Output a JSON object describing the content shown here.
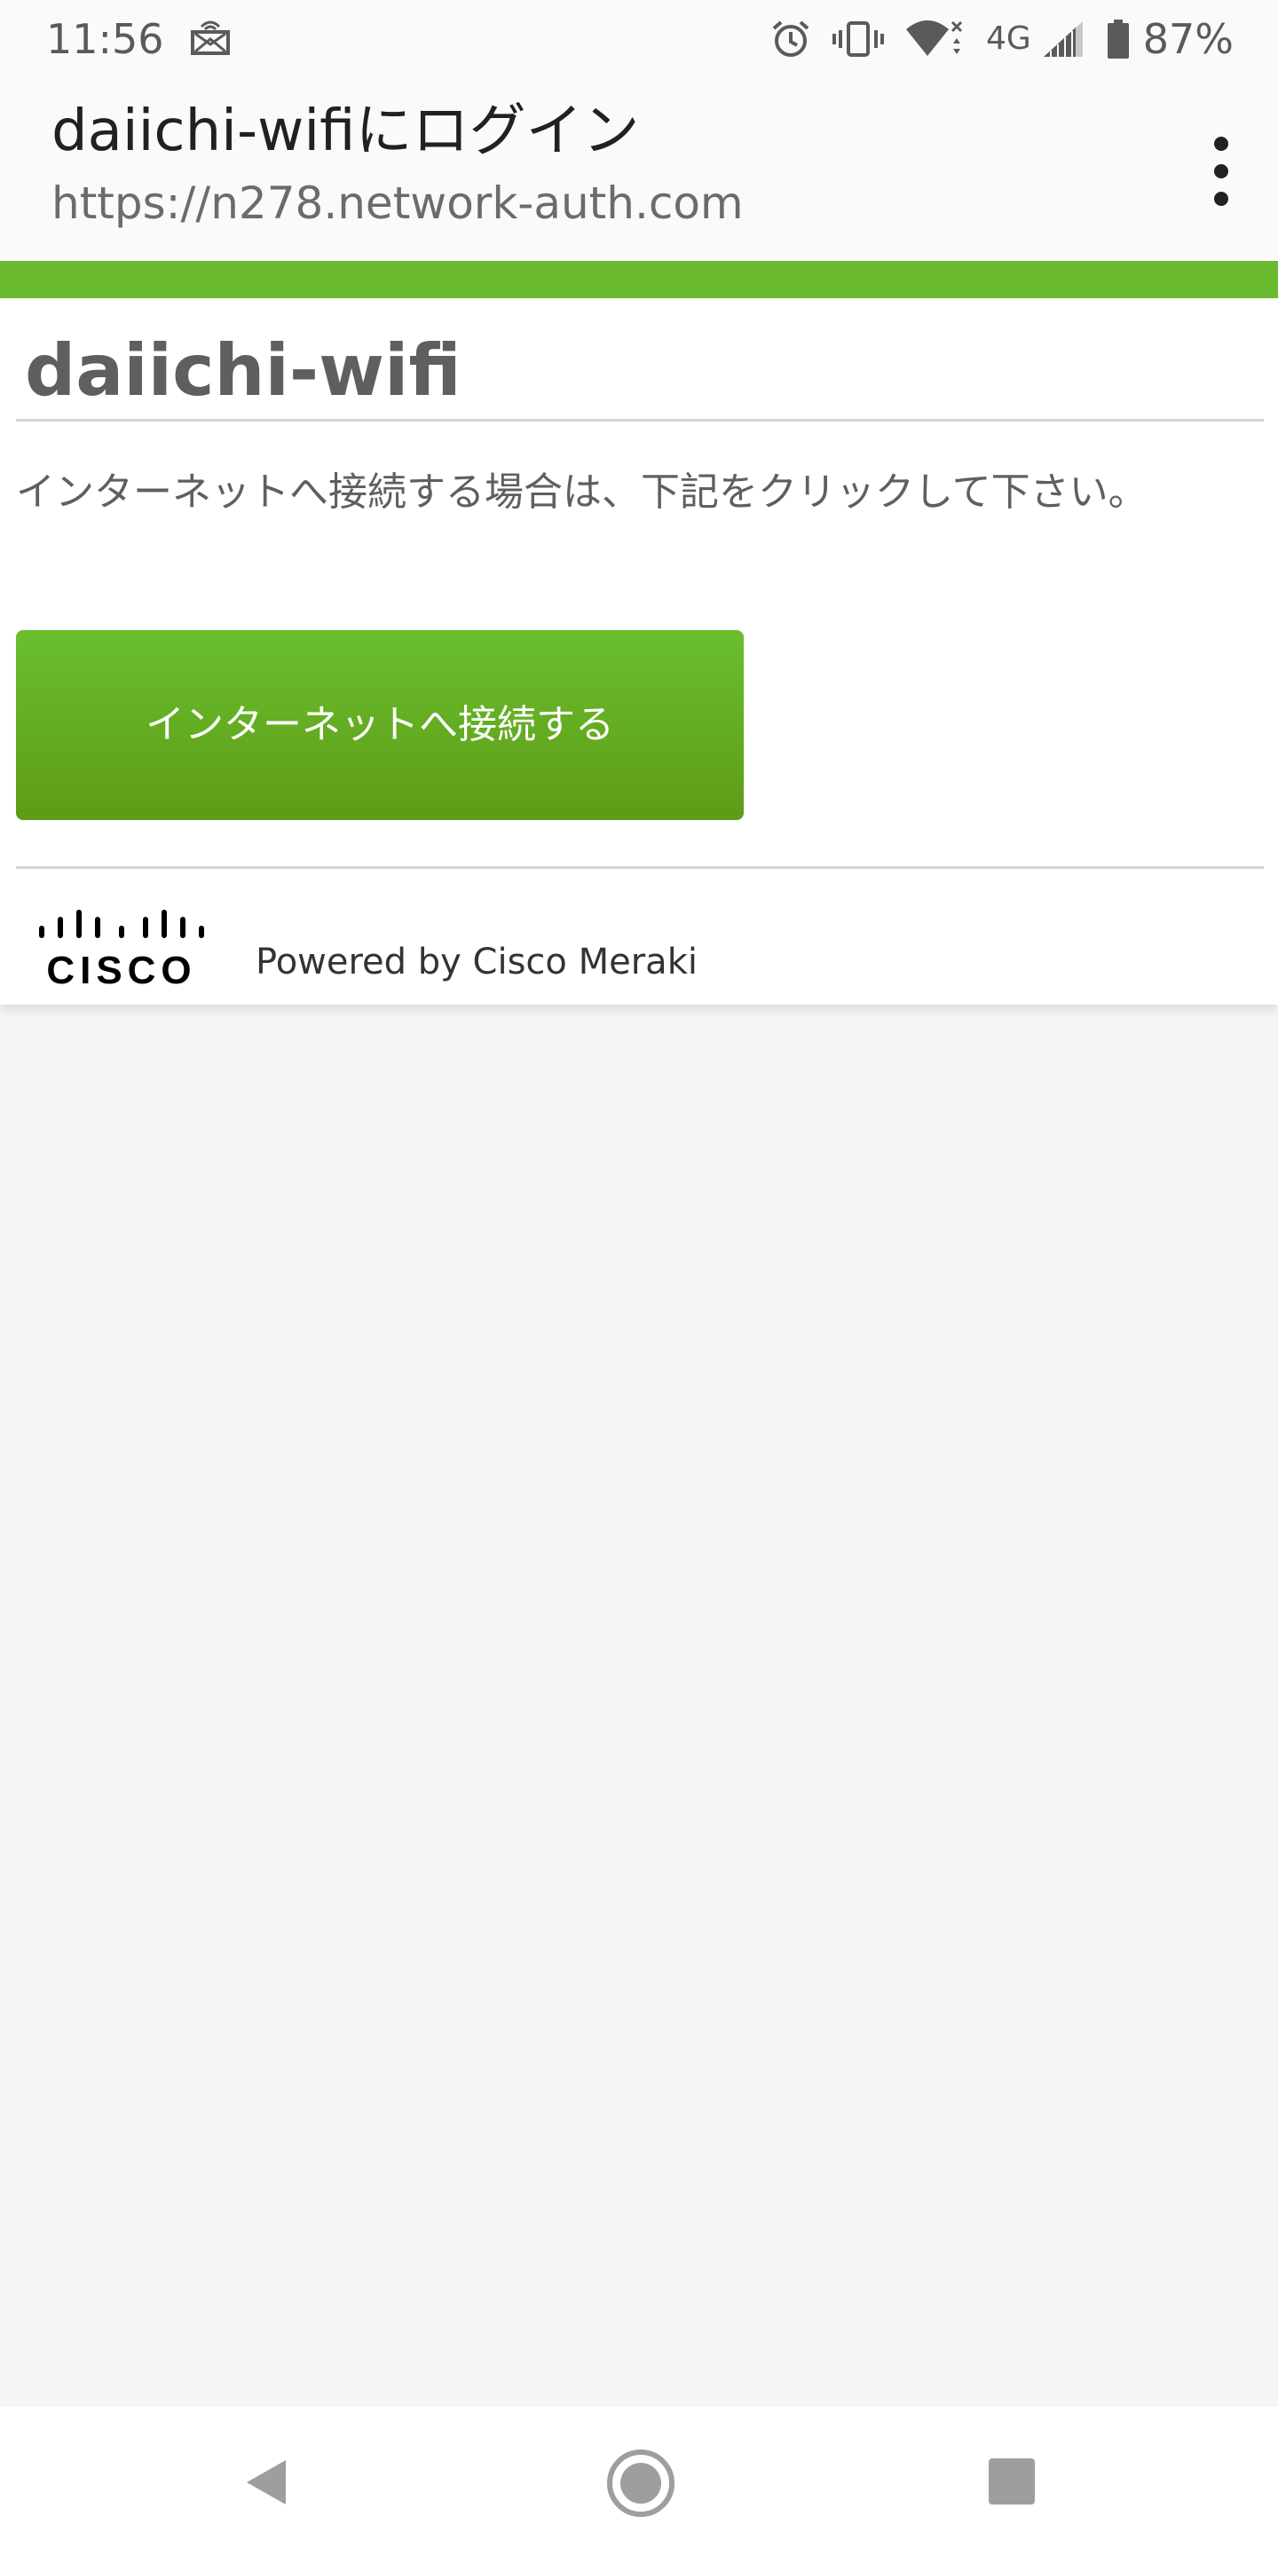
{
  "status_bar": {
    "time": "11:56",
    "network": "4G",
    "battery": "87%",
    "icons": [
      "cast-icon",
      "alarm-icon",
      "vibrate-icon",
      "wifi-icon",
      "signal-icon",
      "battery-icon"
    ]
  },
  "browser": {
    "title": "daiichi-wifiにログイン",
    "url": "https://n278.network-auth.com",
    "menu_icon": "more-vert-icon"
  },
  "page": {
    "accent_color": "#6abb2f",
    "network_name": "daiichi-wifi",
    "instructions": "インターネットへ接続する場合は、下記をクリックして下さい。",
    "connect_button": "インターネットへ接続する",
    "button_color": "#64ad22",
    "footer": {
      "logo": "cisco-logo",
      "logo_text": "CISCO",
      "powered_by": "Powered by Cisco Meraki"
    }
  },
  "nav_bar": {
    "icons": [
      "back-icon",
      "home-icon",
      "recents-icon"
    ]
  }
}
